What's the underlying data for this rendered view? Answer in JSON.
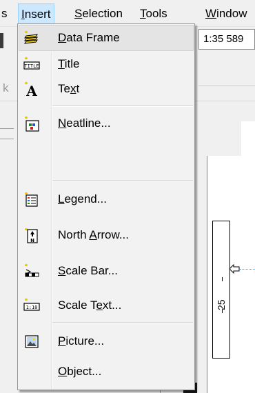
{
  "menubar": {
    "partial_left": "s",
    "insert": {
      "label": "Insert",
      "mnemonic": "I",
      "rest": "nsert"
    },
    "selection": {
      "mnemonic": "S",
      "rest": "election"
    },
    "tools": {
      "mnemonic": "T",
      "rest": "ools"
    },
    "window": {
      "mnemonic": "W",
      "rest": "indow"
    }
  },
  "toolbar": {
    "scale_value": "1:35 589"
  },
  "background": {
    "row2_partial": "k",
    "ruler_label": "25"
  },
  "insert_menu": {
    "items": [
      {
        "icon": "data-frame-icon",
        "pre": "",
        "mnemonic": "D",
        "post": "ata Frame",
        "highlighted": true
      },
      {
        "icon": "title-icon",
        "pre": "",
        "mnemonic": "T",
        "post": "itle",
        "highlighted": false
      },
      {
        "icon": "text-icon",
        "pre": "Te",
        "mnemonic": "x",
        "post": "t",
        "highlighted": false
      },
      {
        "icon": "neatline-icon",
        "pre": "",
        "mnemonic": "N",
        "post": "eatline...",
        "highlighted": false
      },
      {
        "icon": "legend-icon",
        "pre": "",
        "mnemonic": "L",
        "post": "egend...",
        "highlighted": false
      },
      {
        "icon": "north-arrow-icon",
        "pre": "North ",
        "mnemonic": "A",
        "post": "rrow...",
        "highlighted": false
      },
      {
        "icon": "scale-bar-icon",
        "pre": "",
        "mnemonic": "S",
        "post": "cale Bar...",
        "highlighted": false
      },
      {
        "icon": "scale-text-icon",
        "pre": "Scale T",
        "mnemonic": "e",
        "post": "xt...",
        "highlighted": false
      },
      {
        "icon": "picture-icon",
        "pre": "",
        "mnemonic": "P",
        "post": "icture...",
        "highlighted": false
      },
      {
        "icon": "",
        "pre": "",
        "mnemonic": "O",
        "post": "bject...",
        "highlighted": false
      }
    ]
  },
  "colors": {
    "menu_highlight": "#cce8ff",
    "menu_highlight_border": "#99d1ff",
    "item_hover": "#e4e4e4"
  }
}
